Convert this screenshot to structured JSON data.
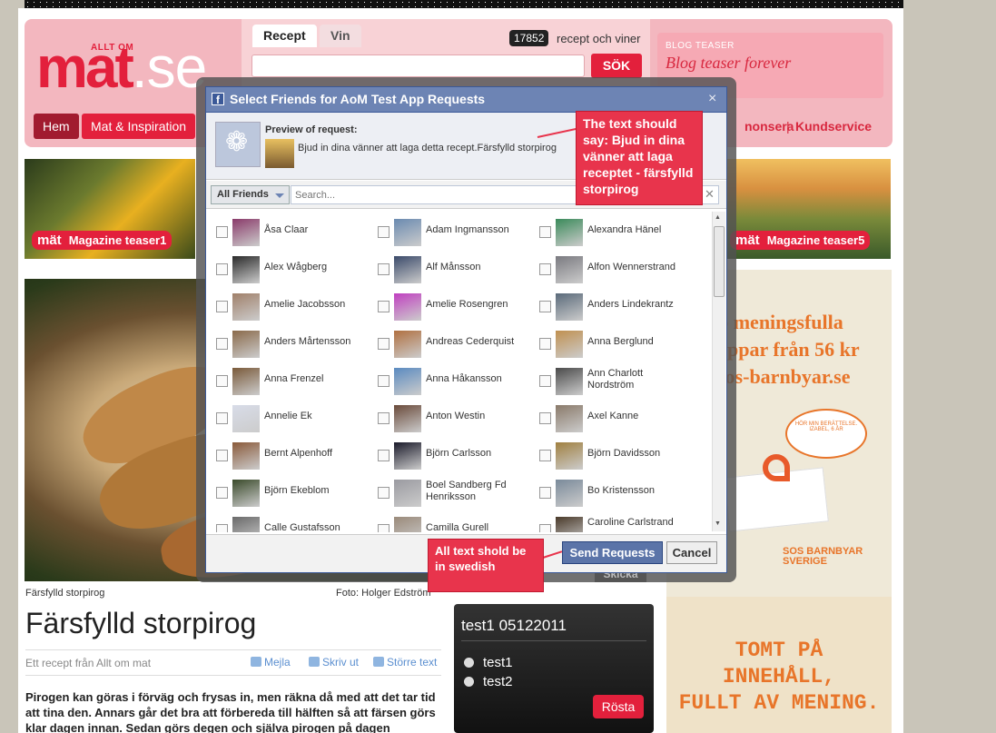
{
  "header": {
    "logo_small": "ALLT OM",
    "logo_main": "mat",
    "logo_suffix": ".se",
    "tabs": [
      "Recept",
      "Vin"
    ],
    "recipe_count": "17852",
    "recipe_count_label": "recept och viner",
    "search_button": "SÖK",
    "blog_small": "BLOG TEASER",
    "blog_title": "Blog teaser forever",
    "nav": [
      "Hem",
      "Mat & Inspiration"
    ],
    "nav_right": [
      "nonsera",
      "Kundservice"
    ]
  },
  "teasers": [
    {
      "logo": "mät",
      "label": "Magazine teaser1"
    },
    {
      "logo": "mät",
      "label": "Magazine teaser5"
    }
  ],
  "article": {
    "caption": "Färsfylld storpirog",
    "credit": "Foto: Holger Edström",
    "title": "Färsfylld storpirog",
    "byline": "Ett recept från Allt om mat",
    "tools": [
      "Mejla",
      "Skriv ut",
      "Större text"
    ],
    "intro": "Pirogen kan göras i förväg och frysas in, men räkna då med att det tar tid att tina den. Annars går det bra att förbereda till hälften så att färsen görs klar dagen innan. Sedan görs degen och själva pirogen på dagen"
  },
  "poll": {
    "title": "test1 05122011",
    "options": [
      "test1",
      "test2"
    ],
    "button": "Rösta"
  },
  "ad": {
    "lines": [
      "p meningsfulla",
      "appar från 56 kr",
      "sos-barnbyar.se"
    ],
    "bubble": "HÖR MIN BERÄTTELSE. IZABEL, 6 ÅR",
    "logo_line1": "SOS BARNBYAR",
    "logo_line2": "SVERIGE",
    "bottom_lines": [
      "TOMT PÅ",
      "INNEHÅLL,",
      "FULLT AV MENING."
    ]
  },
  "dialog": {
    "title": "Select Friends for AoM Test App Requests",
    "close": "×",
    "preview_label": "Preview of request:",
    "preview_text": "Bjud in dina vänner att laga detta recept.Färsfylld storpirog",
    "filter": "All Friends",
    "search_placeholder": "Search...",
    "send_button": "Send Requests",
    "cancel_button": "Cancel",
    "behind_button": "Skicka",
    "friends": [
      [
        "Åsa Claar",
        "Adam Ingmansson",
        "Alexandra Hänel"
      ],
      [
        "Alex Wågberg",
        "Alf Månsson",
        "Alfon Wennerstrand"
      ],
      [
        "Amelie Jacobsson",
        "Amelie Rosengren",
        "Anders Lindekrantz"
      ],
      [
        "Anders Mårtensson",
        "Andreas Cederquist",
        "Anna Berglund"
      ],
      [
        "Anna Frenzel",
        "Anna Håkansson",
        "Ann Charlott Nordström"
      ],
      [
        "Annelie Ek",
        "Anton Westin",
        "Axel Kanne"
      ],
      [
        "Bernt Alpenhoff",
        "Björn Carlsson",
        "Björn Davidsson"
      ],
      [
        "Björn Ekeblom",
        "Boel Sandberg Fd Henriksson",
        "Bo Kristensson"
      ],
      [
        "Calle Gustafsson",
        "Camilla Gurell",
        "Caroline Carlstrand"
      ]
    ]
  },
  "notes": {
    "note1": "The text should say: Bjud in dina vänner att laga receptet - färsfylld storpirog",
    "note2": "All text shold be in swedish"
  }
}
